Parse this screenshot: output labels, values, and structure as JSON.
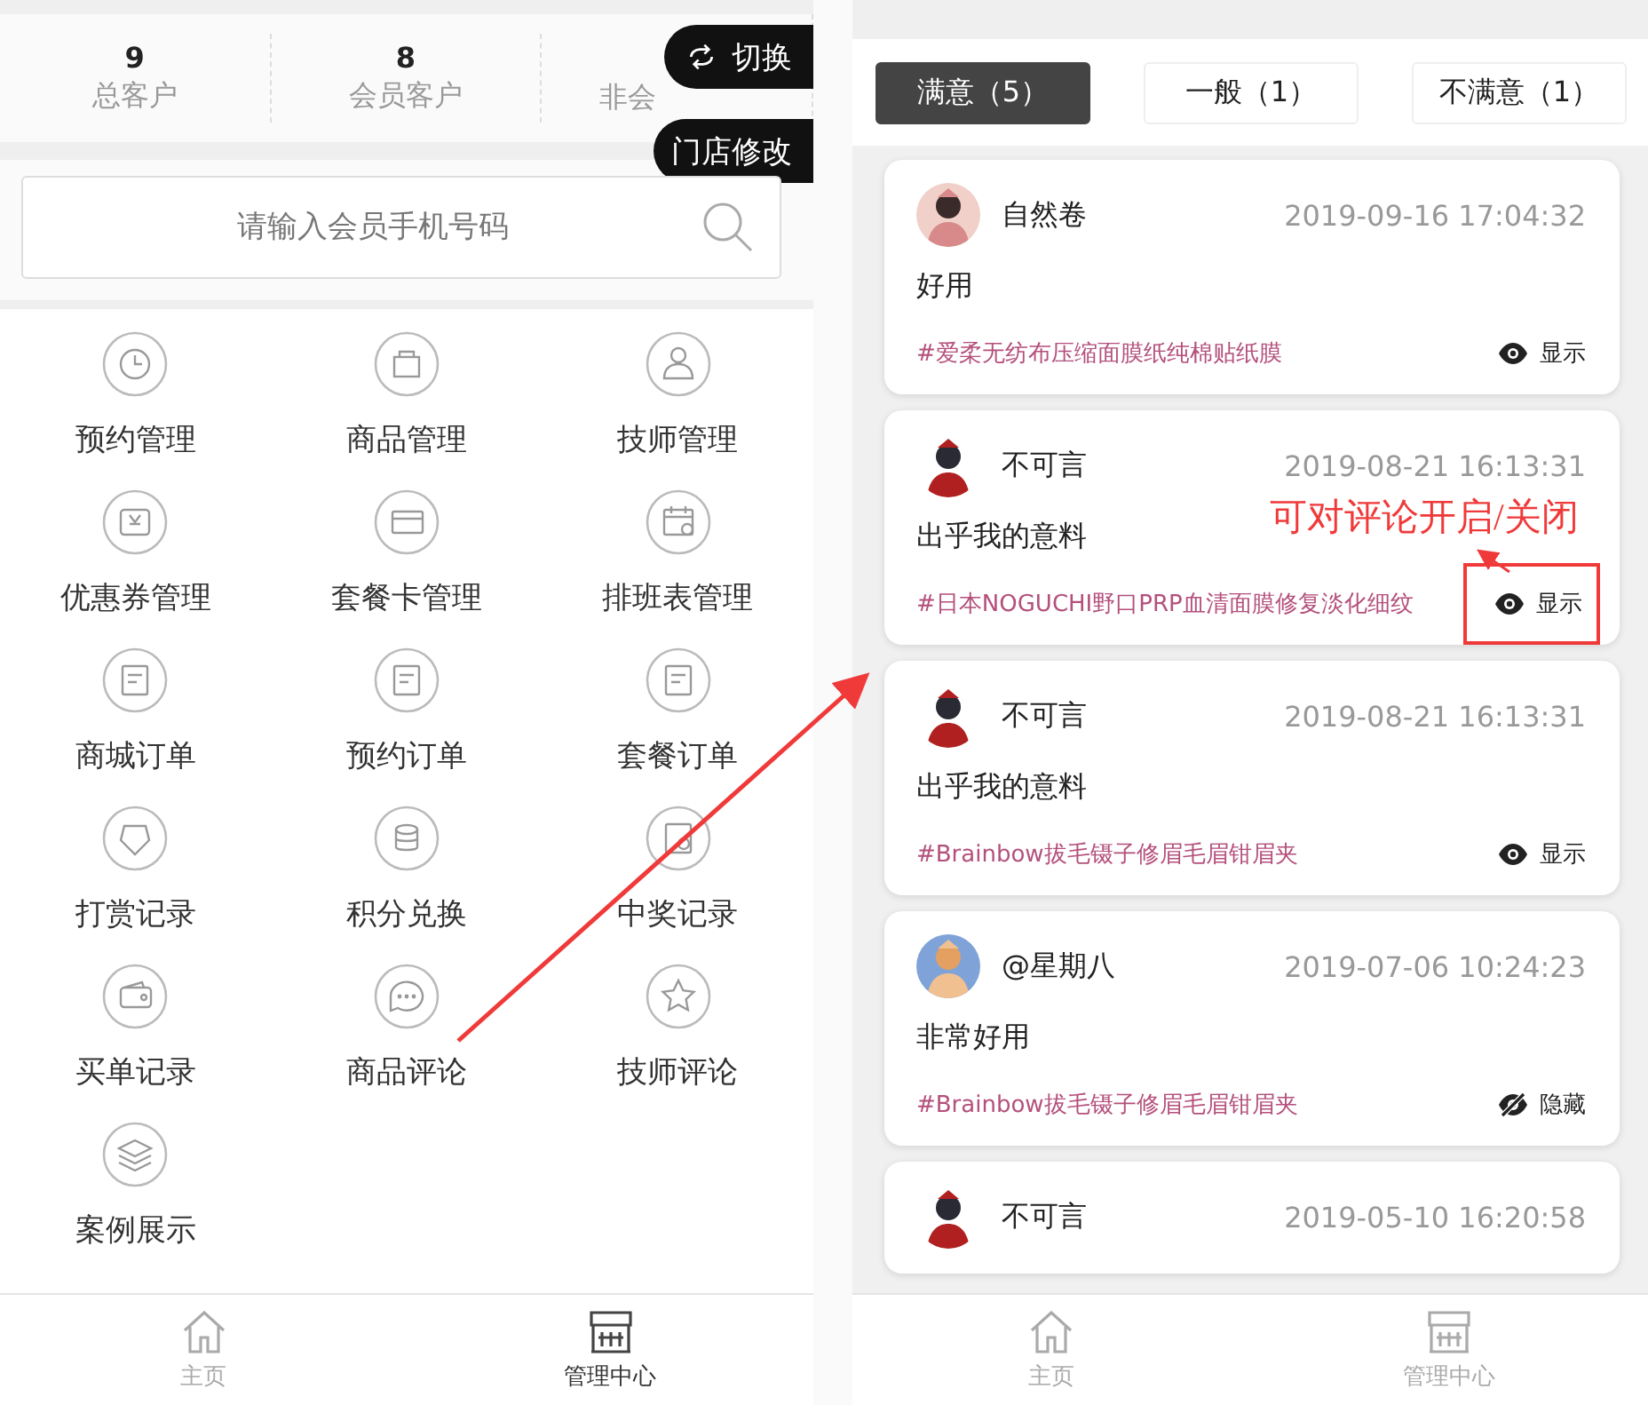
{
  "left_screen": {
    "stats": [
      {
        "value": "9",
        "label": "总客户"
      },
      {
        "value": "8",
        "label": "会员客户"
      },
      {
        "label": "非会"
      }
    ],
    "float_buttons": [
      {
        "kind": "switch",
        "label": "切换"
      },
      {
        "kind": "edit",
        "label": "门店修改"
      }
    ],
    "search": {
      "placeholder": "请输入会员手机号码"
    },
    "menu": [
      "预约管理",
      "商品管理",
      "技师管理",
      "优惠券管理",
      "套餐卡管理",
      "排班表管理",
      "商城订单",
      "预约订单",
      "套餐订单",
      "打赏记录",
      "积分兑换",
      "中奖记录",
      "买单记录",
      "商品评论",
      "技师评论",
      "案例展示"
    ],
    "tab_bar": [
      {
        "label": "主页",
        "selected": false
      },
      {
        "label": "管理中心",
        "selected": true
      }
    ]
  },
  "right_screen": {
    "filters": [
      {
        "label": "满意（5）",
        "selected": true
      },
      {
        "label": "一般（1）",
        "selected": false
      },
      {
        "label": "不满意（1）",
        "selected": false
      }
    ],
    "reviews": [
      {
        "user": "自然卷",
        "time": "2019-09-16 17:04:32",
        "text": "好用",
        "product": "#爱柔无纺布压缩面膜纸纯棉贴纸膜",
        "visibility": {
          "visible": true,
          "label": "显示",
          "highlighted": false
        }
      },
      {
        "user": "不可言",
        "time": "2019-08-21 16:13:31",
        "text": "出乎我的意料",
        "product": "#日本NOGUCHI野口PRP血清面膜修复淡化细纹",
        "visibility": {
          "visible": true,
          "label": "显示",
          "highlighted": true
        }
      },
      {
        "user": "不可言",
        "time": "2019-08-21 16:13:31",
        "text": "出乎我的意料",
        "product": "#Brainbow拔毛镊子修眉毛眉钳眉夹",
        "visibility": {
          "visible": true,
          "label": "显示",
          "highlighted": false
        }
      },
      {
        "user": "@星期八",
        "time": "2019-07-06 10:24:23",
        "text": "非常好用",
        "product": "#Brainbow拔毛镊子修眉毛眉钳眉夹",
        "visibility": {
          "visible": false,
          "label": "隐藏",
          "highlighted": false
        }
      },
      {
        "user": "不可言",
        "time": "2019-05-10 16:20:58"
      }
    ],
    "tab_bar": [
      {
        "label": "主页",
        "selected": false
      },
      {
        "label": "管理中心",
        "selected": false
      }
    ]
  },
  "annotation": {
    "text": "可对评论开启/关闭"
  }
}
